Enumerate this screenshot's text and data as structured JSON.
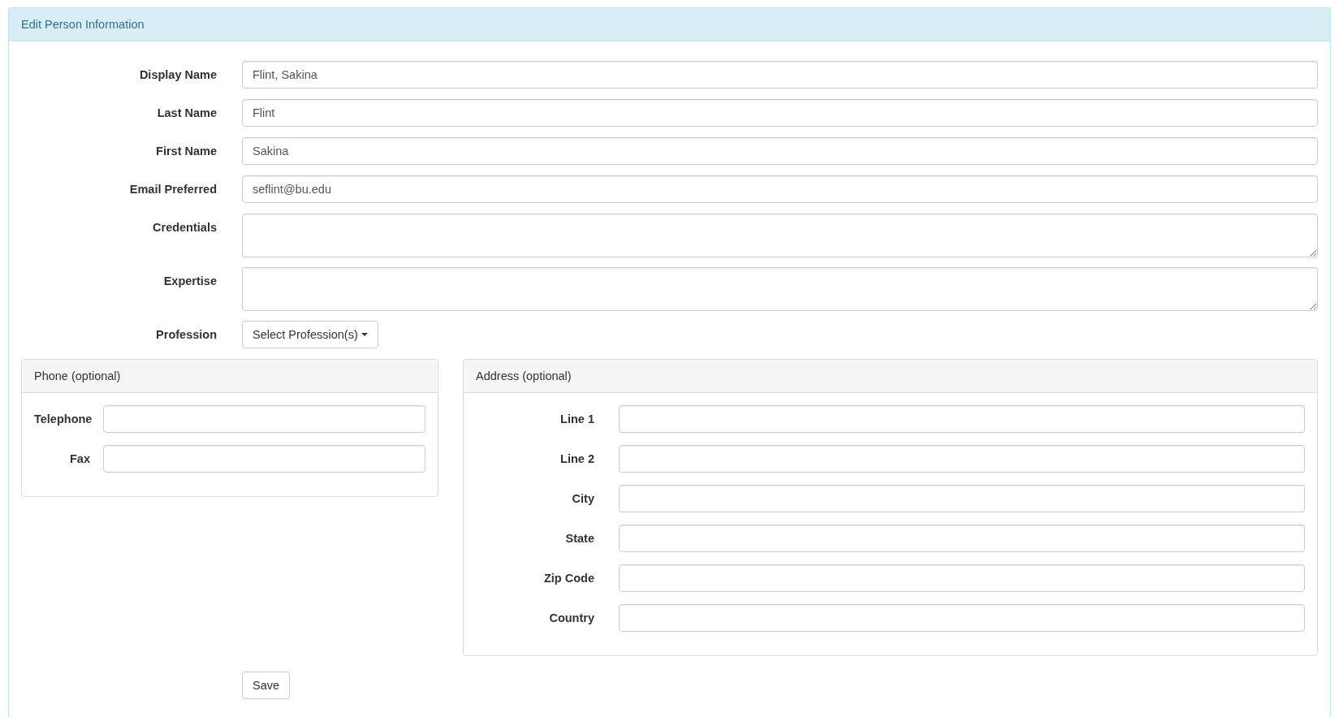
{
  "panel": {
    "title": "Edit Person Information"
  },
  "fields": [
    {
      "label": "Display Name",
      "kind": "input",
      "value": "Flint, Sakina"
    },
    {
      "label": "Last Name",
      "kind": "input",
      "value": "Flint"
    },
    {
      "label": "First Name",
      "kind": "input",
      "value": "Sakina"
    },
    {
      "label": "Email Preferred",
      "kind": "input",
      "value": "seflint@bu.edu"
    },
    {
      "label": "Credentials",
      "kind": "textarea"
    },
    {
      "label": "Expertise",
      "kind": "textarea"
    },
    {
      "label": "Profession",
      "kind": "dropdown",
      "value": "Select Profession(s)"
    }
  ],
  "phone": {
    "title": "Phone (optional)",
    "fields": [
      {
        "label": "Telephone"
      },
      {
        "label": "Fax"
      }
    ]
  },
  "address": {
    "title": "Address (optional)",
    "fields": [
      {
        "label": "Line 1"
      },
      {
        "label": "Line 2"
      },
      {
        "label": "City"
      },
      {
        "label": "State"
      },
      {
        "label": "Zip Code"
      },
      {
        "label": "Country"
      }
    ]
  },
  "save": "Save"
}
